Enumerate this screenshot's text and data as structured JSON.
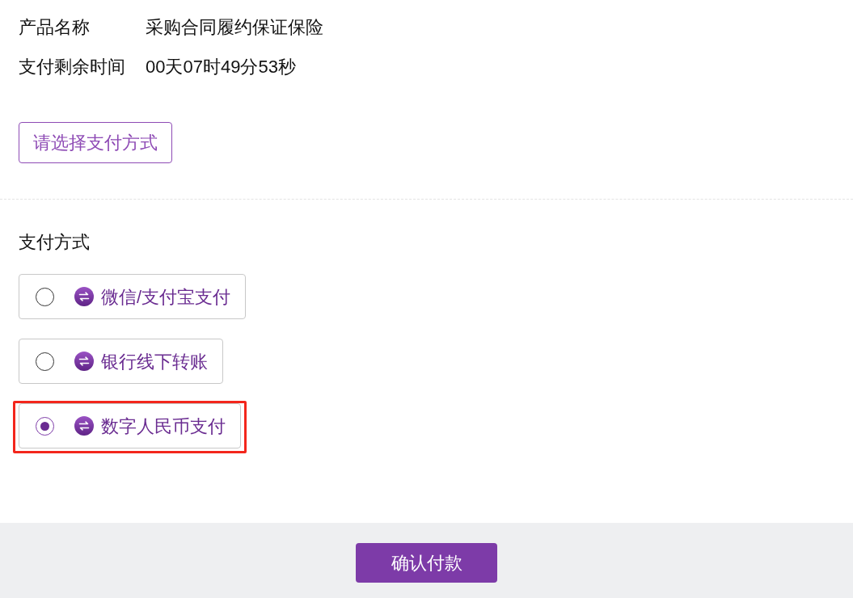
{
  "info_rows": [
    {
      "label": "产品名称",
      "value": "采购合同履约保证保险"
    },
    {
      "label": "支付剩余时间",
      "value": "00天07时49分53秒"
    }
  ],
  "select_button": {
    "label": "请选择支付方式"
  },
  "payment_section": {
    "title": "支付方式",
    "options": [
      {
        "label": "微信/支付宝支付",
        "selected": false,
        "highlighted": false
      },
      {
        "label": "银行线下转账",
        "selected": false,
        "highlighted": false
      },
      {
        "label": "数字人民币支付",
        "selected": true,
        "highlighted": true
      }
    ]
  },
  "footer": {
    "confirm_button": {
      "label": "确认付款"
    }
  }
}
